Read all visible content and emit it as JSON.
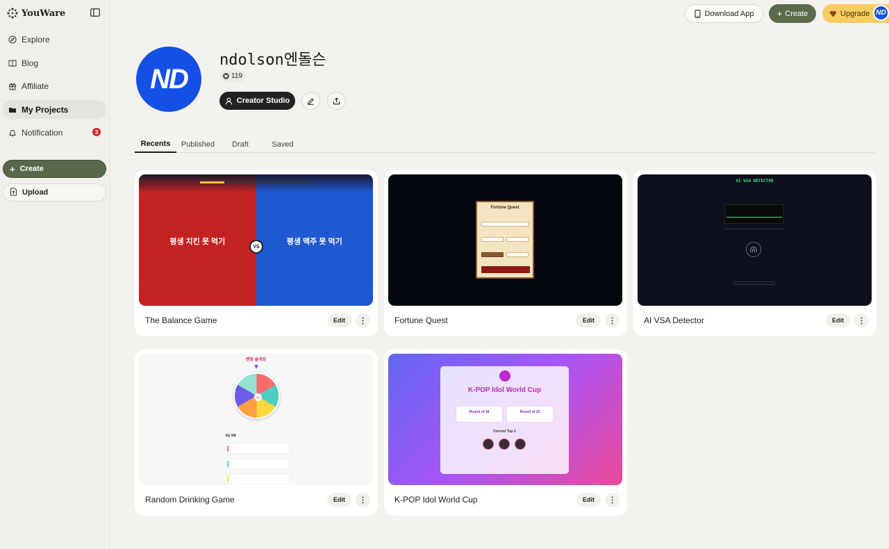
{
  "app": {
    "name": "YouWare"
  },
  "sidebar": {
    "items": [
      {
        "label": "Explore",
        "icon": "compass-icon"
      },
      {
        "label": "Blog",
        "icon": "book-icon"
      },
      {
        "label": "Affiliate",
        "icon": "gift-icon"
      },
      {
        "label": "My Projects",
        "icon": "folder-icon",
        "active": true
      },
      {
        "label": "Notification",
        "icon": "bell-icon",
        "badge": "3"
      }
    ],
    "create_label": "Create",
    "upload_label": "Upload"
  },
  "topbar": {
    "download_label": "Download App",
    "create_label": "Create",
    "upgrade_label": "Upgrade",
    "avatar_initials": "ND"
  },
  "profile": {
    "avatar_initials": "ND",
    "name": "ndolson엔돌슨",
    "followers": "119",
    "studio_label": "Creator Studio"
  },
  "tabs": [
    "Recents",
    "Published",
    "Draft",
    "Saved"
  ],
  "projects": [
    {
      "title": "The Balance Game",
      "edit_label": "Edit",
      "thumb": {
        "left_text": "평생 치킨 못 먹기",
        "right_text": "평생 맥주 못 먹기",
        "vs": "VS"
      }
    },
    {
      "title": "Fortune Quest",
      "edit_label": "Edit",
      "thumb": {
        "heading": "Fortune Quest"
      }
    },
    {
      "title": "AI VSA Detector",
      "edit_label": "Edit",
      "thumb": {
        "heading": "AI VSA DETECTOR"
      }
    },
    {
      "title": "Random Drinking Game",
      "edit_label": "Edit",
      "thumb": {
        "heading": "랜덤 술게임",
        "wheel_center": "SPIN",
        "list_heading": "게임 목록"
      }
    },
    {
      "title": "K-POP Idol World Cup",
      "edit_label": "Edit",
      "thumb": {
        "heading": "K-POP Idol World Cup",
        "round_a": "Round of 16",
        "round_b": "Round of 32",
        "top_label": "Current Top 3"
      }
    }
  ],
  "colors": {
    "accent_green": "#5a6b4c",
    "brand_blue": "#1450e6",
    "upgrade_yellow": "#f7cc63",
    "badge_red": "#d9262e"
  }
}
